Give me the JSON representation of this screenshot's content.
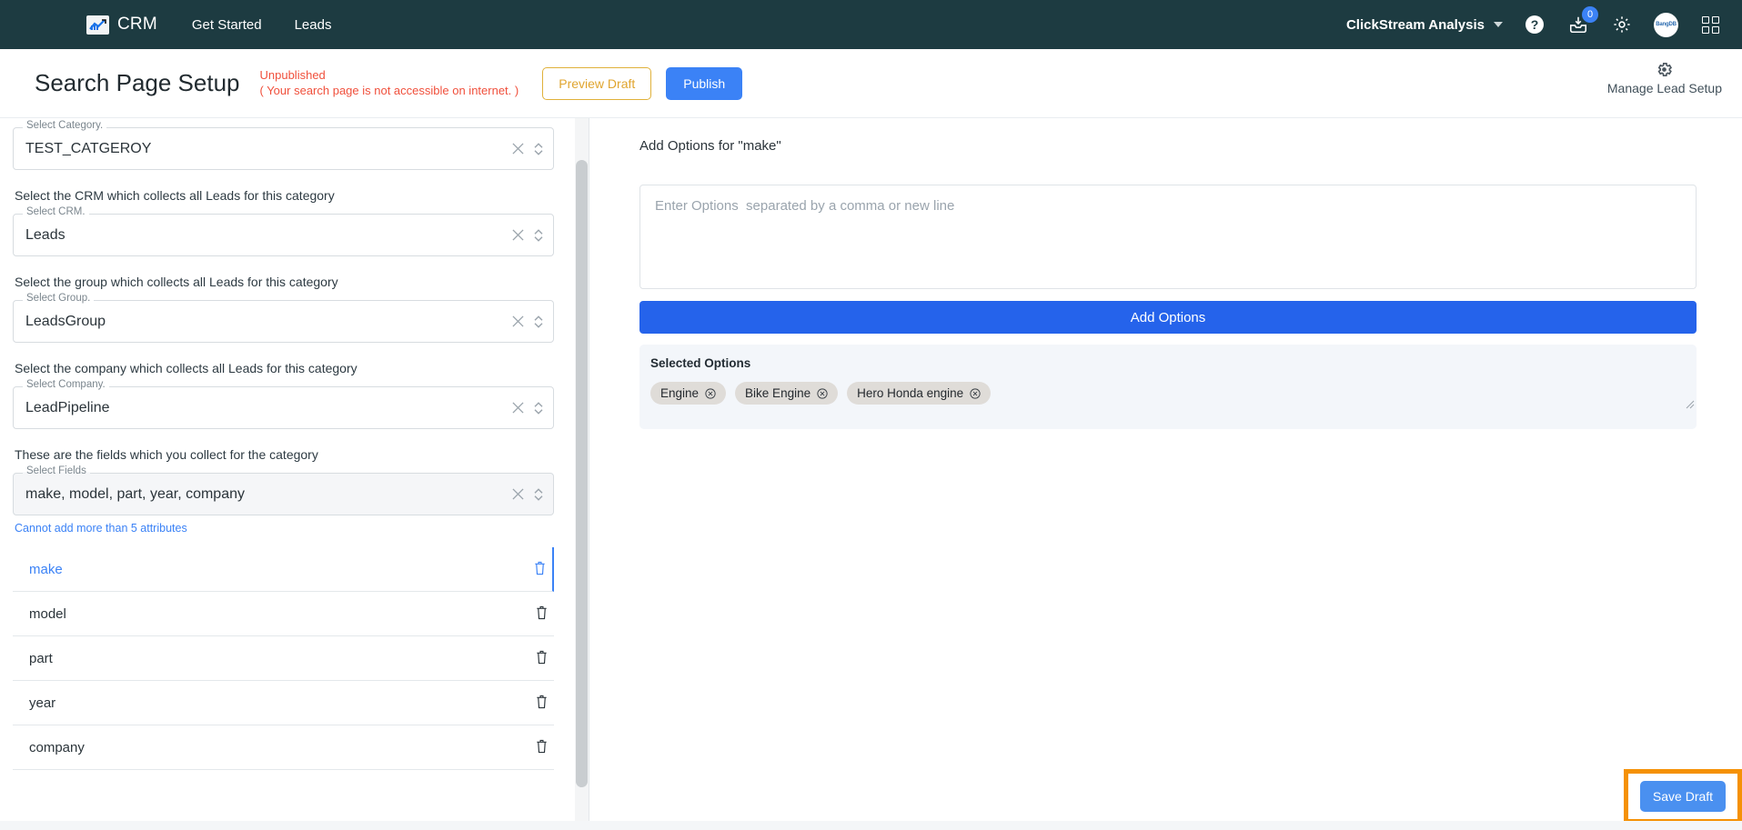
{
  "navbar": {
    "brand": "CRM",
    "links": [
      {
        "label": "Get Started"
      },
      {
        "label": "Leads"
      }
    ],
    "workspace": "ClickStream Analysis",
    "help_icon": "help-circle-icon",
    "inbox_icon": "inbox-download-icon",
    "inbox_badge": "0",
    "settings_icon": "gear-icon",
    "avatar_label": "BangDB",
    "apps_icon": "grid-apps-icon",
    "background_color": "#1d3b41"
  },
  "header": {
    "title": "Search Page Setup",
    "status_title": "Unpublished",
    "status_subtitle": "( Your search page is not accessible on internet. )",
    "status_color": "#f0503c",
    "preview_label": "Preview Draft",
    "publish_label": "Publish",
    "manage_label": "Manage Lead Setup"
  },
  "left_panel": {
    "category": {
      "label": "Select Category.",
      "value": "TEST_CATGEROY"
    },
    "crm_helper": "Select the CRM which collects all Leads for this category",
    "crm": {
      "label": "Select CRM.",
      "value": "Leads"
    },
    "group_helper": "Select the group which collects all Leads for this category",
    "group": {
      "label": "Select Group.",
      "value": "LeadsGroup"
    },
    "company_helper": "Select the company which collects all Leads for this category",
    "company": {
      "label": "Select Company.",
      "value": "LeadPipeline"
    },
    "fields_helper": "These are the fields which you collect for the category",
    "fields_select": {
      "label": "Select Fields",
      "value": "make, model, part, year, company"
    },
    "warning": "Cannot add more than 5 attributes",
    "warning_color": "#3b82f6",
    "field_rows": [
      {
        "name": "make",
        "active": true
      },
      {
        "name": "model",
        "active": false
      },
      {
        "name": "part",
        "active": false
      },
      {
        "name": "year",
        "active": false
      },
      {
        "name": "company",
        "active": false
      }
    ]
  },
  "right_panel": {
    "title": "Add Options for \"make\"",
    "textarea_placeholder": "Enter Options  separated by a comma or new line",
    "textarea_value": "",
    "add_options_label": "Add Options",
    "selected_title": "Selected Options",
    "chips": [
      {
        "label": "Engine"
      },
      {
        "label": "Bike Engine"
      },
      {
        "label": "Hero Honda engine"
      }
    ]
  },
  "footer": {
    "save_draft_label": "Save Draft",
    "highlight_color": "#f59105"
  }
}
